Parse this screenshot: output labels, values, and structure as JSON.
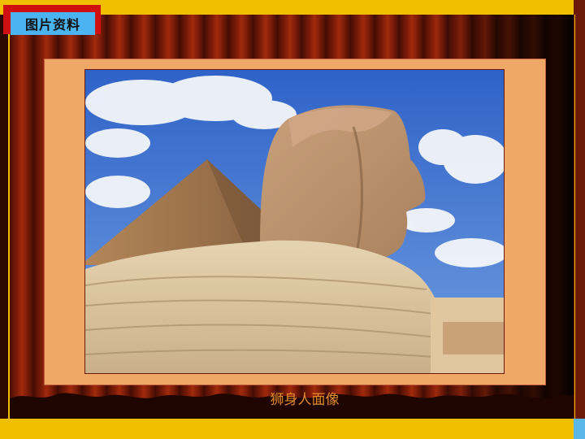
{
  "slide": {
    "title": "图片资料",
    "caption": "狮身人面像",
    "photo": {
      "subject": "sphinx-and-pyramid",
      "label": ""
    }
  },
  "colors": {
    "accent_yellow": "#f0c000",
    "badge_red": "#d01010",
    "badge_blue": "#4ab3f0",
    "frame_orange": "#f0a866",
    "caption_orange": "#e08a2c",
    "curtain_red": "#7d1c08"
  }
}
